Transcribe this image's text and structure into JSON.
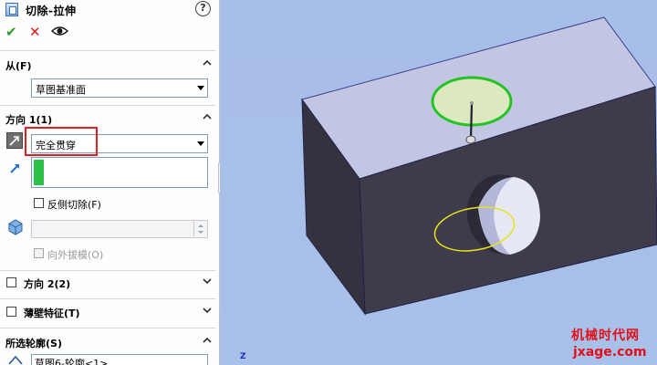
{
  "header": {
    "title": "切除-拉伸",
    "help": "?"
  },
  "actions": {
    "ok": "✔",
    "cancel": "✕"
  },
  "from": {
    "title": "从(F)",
    "value": "草图基准面"
  },
  "direction1": {
    "title": "方向 1(1)",
    "end_condition": "完全贯穿",
    "flip_side_label": "反侧切除(F)",
    "draft_label": "向外拔模(O)"
  },
  "direction2": {
    "title": "方向 2(2)"
  },
  "thin": {
    "title": "薄壁特征(T)"
  },
  "contours": {
    "title": "所选轮廓(S)",
    "item": "草图6-轮廓<1>"
  },
  "watermark": {
    "line1": "机械时代网",
    "line2": "jxage.com"
  },
  "triad": {
    "axis": "Z"
  },
  "colors": {
    "panel_bg": "#fdfdfd",
    "viewport_bg": "#a9bfe6",
    "box_front": "#3c3a49",
    "box_top": "#c2c5e2",
    "sketch_circle": "#20c020",
    "preview_circle": "#e6e010",
    "highlight": "#e21b24",
    "watermark": "#e0101a"
  }
}
